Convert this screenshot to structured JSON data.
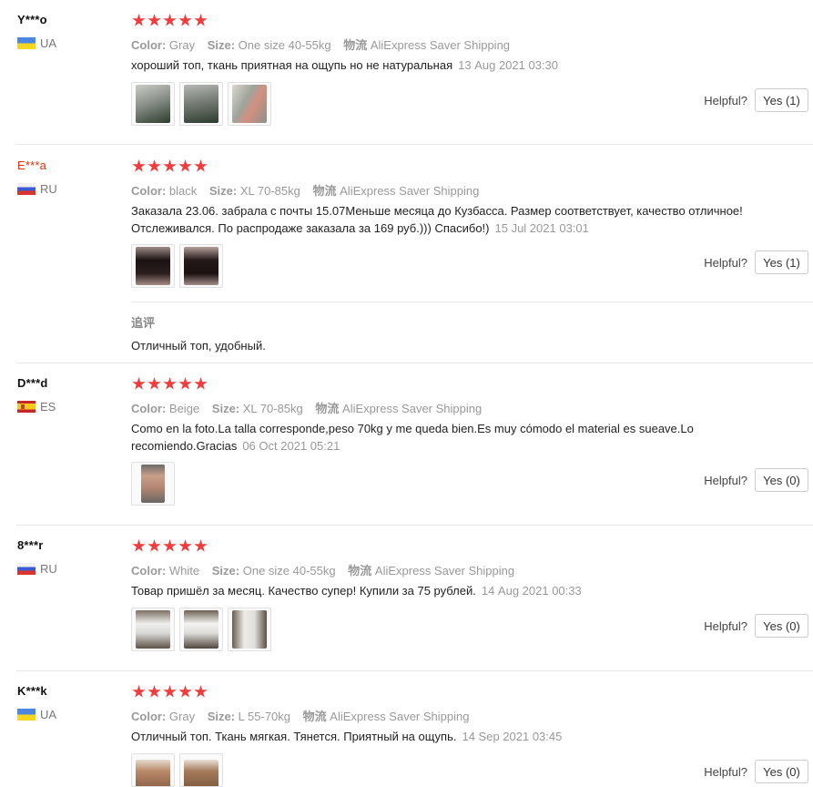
{
  "helpful_label": "Helpful?",
  "labels": {
    "color": "Color:",
    "size": "Size:",
    "logistics": "物流"
  },
  "reviews": [
    {
      "user": "Y***o",
      "country": "UA",
      "color": "Gray",
      "size": "One size 40-55kg",
      "shipping": "AliExpress Saver Shipping",
      "text": "хороший топ, ткань приятная на ощупь но не натуральная",
      "date": "13 Aug 2021 03:30",
      "helpful_button": "Yes (1)"
    },
    {
      "user": "E***a",
      "country": "RU",
      "color": "black",
      "size": "XL 70-85kg",
      "shipping": "AliExpress Saver Shipping",
      "text": "Заказала 23.06. забрала с почты 15.07Меньше месяца до Кузбасса. Размер соответствует, качество отличное! Отслеживался. По распродаже заказала за 169 руб.))) Спасибо!)",
      "date": "15 Jul 2021 03:01",
      "helpful_button": "Yes (1)",
      "additional_label": "追评",
      "additional_text": "Отличный топ, удобный."
    },
    {
      "user": "D***d",
      "country": "ES",
      "color": "Beige",
      "size": "XL 70-85kg",
      "shipping": "AliExpress Saver Shipping",
      "text": "Como en la foto.La talla corresponde,peso 70kg y me queda bien.Es muy cómodo el material es sueave.Lo recomiendo.Gracias",
      "date": "06 Oct 2021 05:21",
      "helpful_button": "Yes (0)"
    },
    {
      "user": "8***r",
      "country": "RU",
      "color": "White",
      "size": "One size 40-55kg",
      "shipping": "AliExpress Saver Shipping",
      "text": "Товар пришёл за месяц. Качество супер! Купили за 75 рублей.",
      "date": "14 Aug 2021 00:33",
      "helpful_button": "Yes (0)"
    },
    {
      "user": "K***k",
      "country": "UA",
      "color": "Gray",
      "size": "L 55-70kg",
      "shipping": "AliExpress Saver Shipping",
      "text": "Отличный топ. Ткань мягкая. Тянется. Приятный на ощупь.",
      "date": "14 Sep 2021 03:45",
      "helpful_button": "Yes (0)"
    }
  ]
}
